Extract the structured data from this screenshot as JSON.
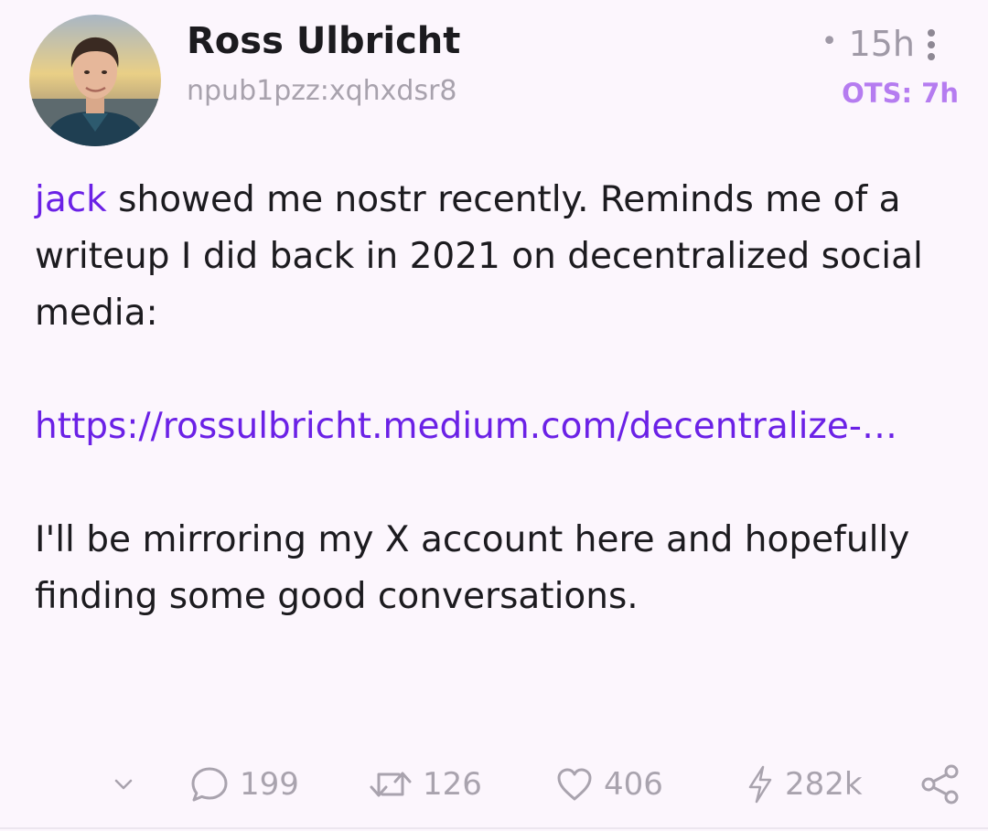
{
  "post": {
    "author_name": "Ross Ulbricht",
    "author_handle": "npub1pzz:xqhxdsr8",
    "time": "15h",
    "ots": "OTS: 7h",
    "content": {
      "mention": "jack",
      "line1_rest": " showed me nostr recently. Reminds me of a writeup I did back in 2021 on decentralized social media:",
      "link": "https://rossulbricht.medium.com/decentralize-…",
      "paragraph2": "I'll be mirroring my X account here and hopefully finding some good conversations."
    },
    "actions": {
      "replies": "199",
      "reposts": "126",
      "likes": "406",
      "zaps": "282k"
    },
    "icons": [
      "avatar",
      "more-vert-icon",
      "chevron-down-icon",
      "comment-icon",
      "repost-icon",
      "heart-icon",
      "lightning-icon",
      "share-icon"
    ],
    "colors": {
      "accent": "#6b21e6",
      "ots": "#b57cf0",
      "muted": "#a9a3ae",
      "background": "#fcf6fd"
    }
  }
}
